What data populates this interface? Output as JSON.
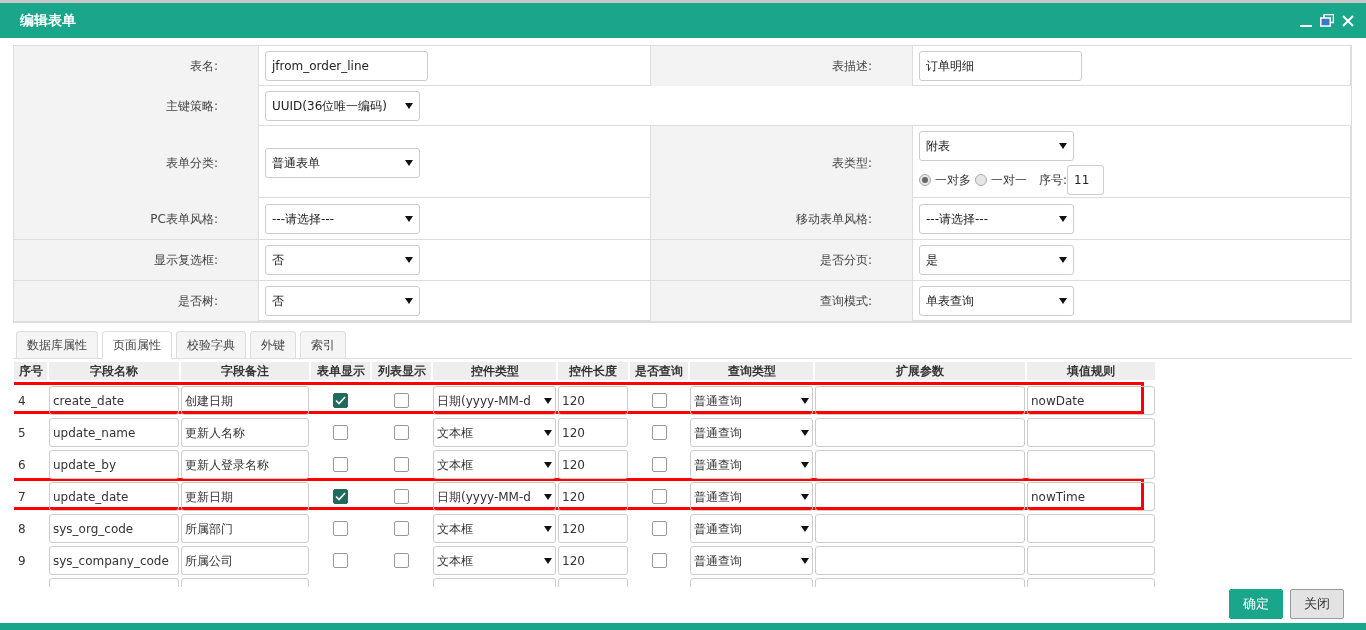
{
  "window": {
    "title": "编辑表单"
  },
  "form": {
    "rows": [
      {
        "cells": [
          {
            "label": "表名:",
            "kind": "input",
            "value": "jfrom_order_line"
          },
          {
            "label": "表描述:",
            "kind": "input",
            "value": "订单明细"
          }
        ]
      },
      {
        "cells": [
          {
            "label": "主键策略:",
            "kind": "select",
            "value": "UUID(36位唯一编码)"
          }
        ]
      },
      {
        "cells": [
          {
            "label": "表单分类:",
            "kind": "select",
            "value": "普通表单"
          },
          {
            "label": "表类型:",
            "kind": "table_type",
            "value": "附表",
            "radios": [
              {
                "label": "一对多",
                "selected": true
              },
              {
                "label": "一对一",
                "selected": false
              }
            ],
            "order_label": "序号:",
            "order_value": "11"
          }
        ]
      },
      {
        "cells": [
          {
            "label": "PC表单风格:",
            "kind": "select",
            "value": "---请选择---"
          },
          {
            "label": "移动表单风格:",
            "kind": "select",
            "value": "---请选择---"
          }
        ]
      },
      {
        "cells": [
          {
            "label": "显示复选框:",
            "kind": "select",
            "value": "否"
          },
          {
            "label": "是否分页:",
            "kind": "select",
            "value": "是"
          }
        ]
      },
      {
        "cells": [
          {
            "label": "是否树:",
            "kind": "select",
            "value": "否"
          },
          {
            "label": "查询模式:",
            "kind": "select",
            "value": "单表查询"
          }
        ]
      }
    ]
  },
  "tabs": [
    {
      "label": "数据库属性",
      "selected": false
    },
    {
      "label": "页面属性",
      "selected": true
    },
    {
      "label": "校验字典",
      "selected": false
    },
    {
      "label": "外键",
      "selected": false
    },
    {
      "label": "索引",
      "selected": false
    }
  ],
  "grid": {
    "columns": [
      "序号",
      "字段名称",
      "字段备注",
      "表单显示",
      "列表显示",
      "控件类型",
      "控件长度",
      "是否查询",
      "查询类型",
      "扩展参数",
      "填值规则"
    ],
    "rows": [
      {
        "no": "4",
        "name": "create_date",
        "remark": "创建日期",
        "form_show": true,
        "list_show": false,
        "control": "日期(yyyy-MM-d",
        "length": "120",
        "query": false,
        "query_type": "普通查询",
        "rule": "nowDate",
        "highlighted": true
      },
      {
        "no": "5",
        "name": "update_name",
        "remark": "更新人名称",
        "form_show": false,
        "list_show": false,
        "control": "文本框",
        "length": "120",
        "query": false,
        "query_type": "普通查询",
        "highlighted": false
      },
      {
        "no": "6",
        "name": "update_by",
        "remark": "更新人登录名称",
        "form_show": false,
        "list_show": false,
        "control": "文本框",
        "length": "120",
        "query": false,
        "query_type": "普通查询",
        "highlighted": false
      },
      {
        "no": "7",
        "name": "update_date",
        "remark": "更新日期",
        "form_show": true,
        "list_show": false,
        "control": "日期(yyyy-MM-d",
        "length": "120",
        "query": false,
        "query_type": "普通查询",
        "rule": "nowTime",
        "highlighted": true
      },
      {
        "no": "8",
        "name": "sys_org_code",
        "remark": "所属部门",
        "form_show": false,
        "list_show": false,
        "control": "文本框",
        "length": "120",
        "query": false,
        "query_type": "普通查询",
        "highlighted": false
      },
      {
        "no": "9",
        "name": "sys_company_code",
        "remark": "所属公司",
        "form_show": false,
        "list_show": false,
        "control": "文本框",
        "length": "120",
        "query": false,
        "query_type": "普通查询",
        "highlighted": false
      }
    ]
  },
  "buttons": [
    {
      "label": "确定",
      "kind": "primary"
    },
    {
      "label": "关闭",
      "kind": "secondary"
    }
  ]
}
